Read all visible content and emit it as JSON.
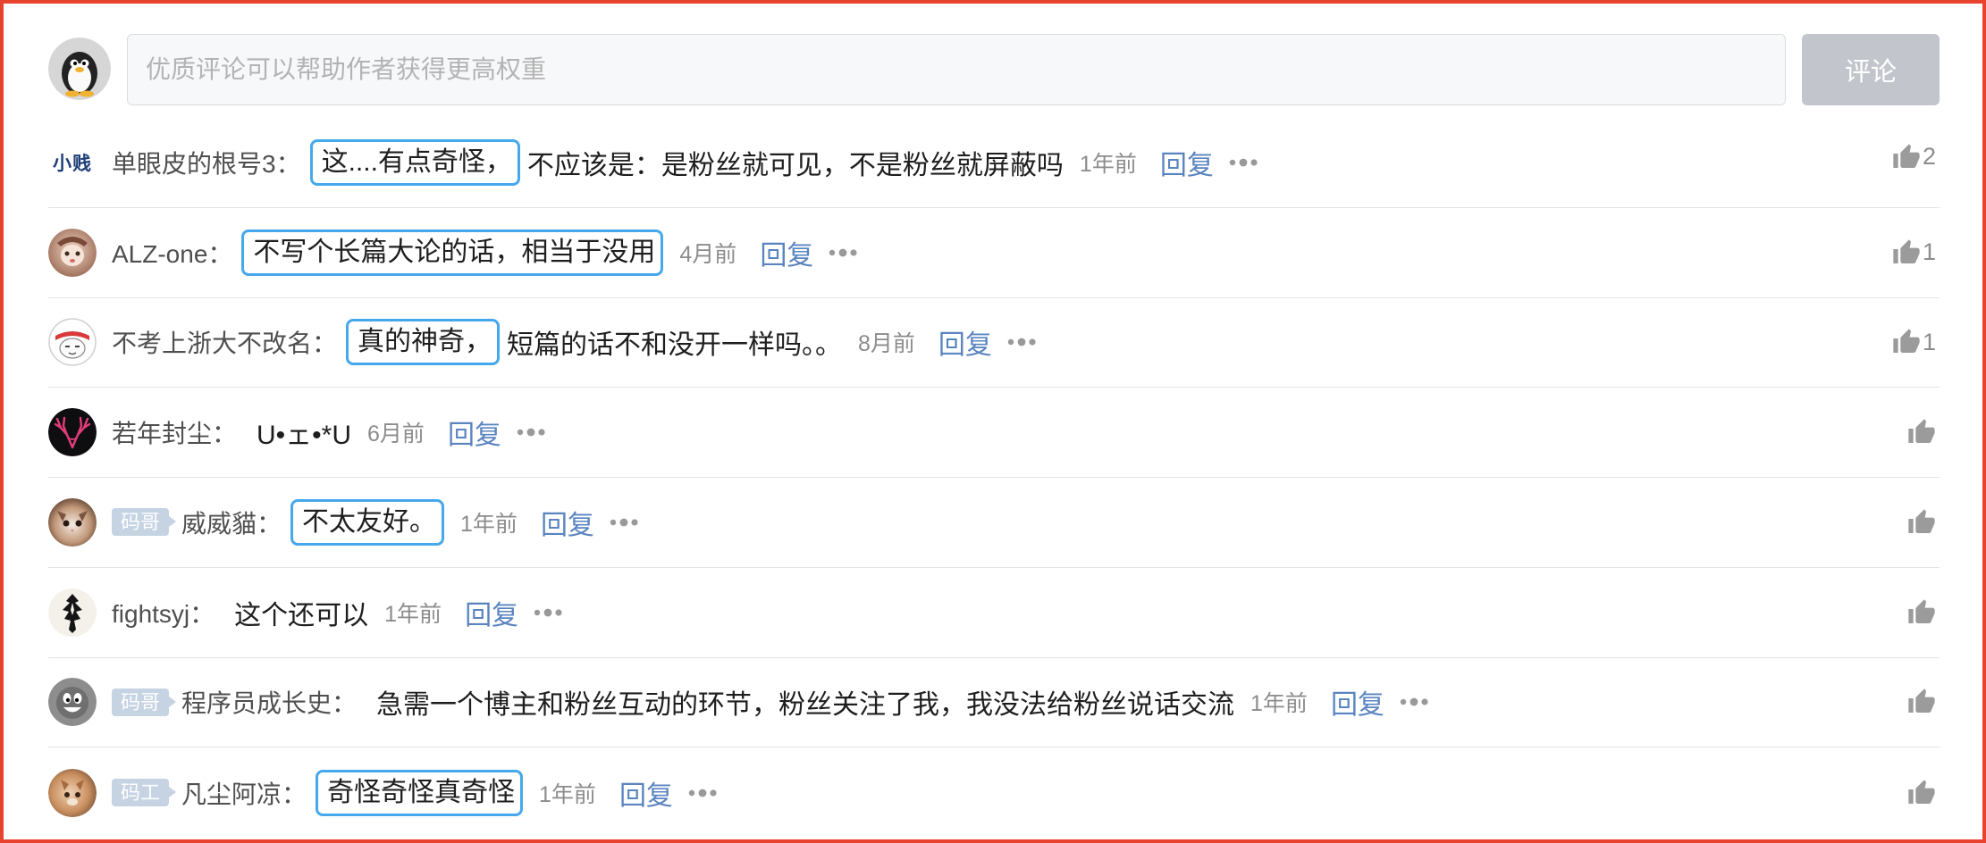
{
  "comment_box": {
    "placeholder": "优质评论可以帮助作者获得更高权重",
    "submit_label": "评论"
  },
  "comments": [
    {
      "avatar_text": "小贱",
      "user": "单眼皮的根号3：",
      "highlight": "这....有点奇怪，",
      "text": "不应该是：是粉丝就可见，不是粉丝就屏蔽吗",
      "time": "1年前",
      "reply_label": "回复",
      "likes": "2"
    },
    {
      "user": "ALZ-one：",
      "highlight": "不写个长篇大论的话，相当于没用",
      "time": "4月前",
      "reply_label": "回复",
      "likes": "1"
    },
    {
      "user": "不考上浙大不改名：",
      "highlight": "真的神奇，",
      "text": "短篇的话不和没开一样吗。。",
      "time": "8月前",
      "reply_label": "回复",
      "likes": "1"
    },
    {
      "user": "若年封尘：",
      "text": "U•ェ•*U",
      "time": "6月前",
      "reply_label": "回复"
    },
    {
      "badge": "码哥",
      "user": "威威貓：",
      "highlight": "不太友好。",
      "time": "1年前",
      "reply_label": "回复"
    },
    {
      "user": "fightsyj：",
      "text": "这个还可以",
      "time": "1年前",
      "reply_label": "回复"
    },
    {
      "badge": "码哥",
      "user": "程序员成长史：",
      "text": "急需一个博主和粉丝互动的环节，粉丝关注了我，我没法给粉丝说话交流",
      "time": "1年前",
      "reply_label": "回复"
    },
    {
      "badge": "码工",
      "user": "凡尘阿凉：",
      "highlight": "奇怪奇怪真奇怪",
      "time": "1年前",
      "reply_label": "回复"
    }
  ],
  "icons": {
    "like": "thumbs-up-icon",
    "more": "more-dots-icon"
  },
  "colors": {
    "frame": "#e8432e",
    "highlight_box": "#46a8ec",
    "reply_link": "#5a84c0",
    "submit_button": "#c3c5cc",
    "badge": "#c5d3e3"
  }
}
